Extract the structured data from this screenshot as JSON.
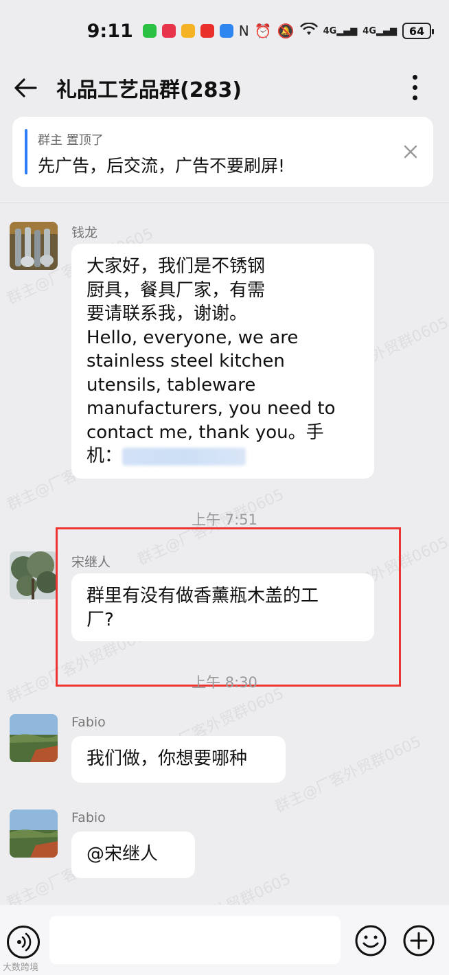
{
  "status_bar": {
    "time": "9:11",
    "battery": "64",
    "signal_1": "4G",
    "signal_2": "4G"
  },
  "header": {
    "title": "礼品工艺品群(283)"
  },
  "pinned": {
    "meta": "群主 置顶了",
    "text": "先广告，后交流，广告不要刷屏!"
  },
  "messages": [
    {
      "sender": "钱龙",
      "lines": [
        "大家好，我们是不锈钢",
        "厨具，餐具厂家，有需",
        "要请联系我，谢谢。",
        "Hello, everyone, we are",
        "stainless steel kitchen",
        "utensils, tableware",
        "manufacturers, you need to",
        "contact me, thank you。手",
        "机："
      ]
    },
    {
      "sender": "宋继人",
      "lines": [
        "群里有没有做香薰瓶木盖的工",
        "厂?"
      ]
    },
    {
      "sender": "Fabio",
      "lines": [
        "我们做，你想要哪种"
      ]
    },
    {
      "sender": "Fabio",
      "lines": [
        "@宋继人"
      ]
    }
  ],
  "timestamps": [
    "上午 7:51",
    "上午 8:30"
  ],
  "watermark": "群主@厂客外贸群0605",
  "bottom_logo": "大数跨境",
  "colors": {
    "background": "#ededf0",
    "accent": "#2e7cf6",
    "highlight": "#e33333"
  }
}
